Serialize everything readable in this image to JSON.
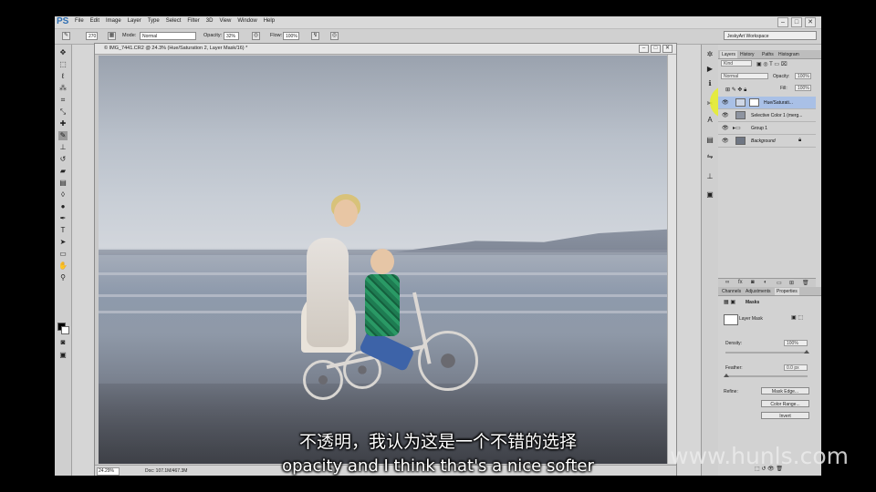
{
  "app": {
    "logo": "PS",
    "menu": [
      "File",
      "Edit",
      "Image",
      "Layer",
      "Type",
      "Select",
      "Filter",
      "3D",
      "View",
      "Window",
      "Help"
    ],
    "window_controls": [
      "–",
      "□",
      "✕"
    ],
    "workspace": "JeskyArt Workspace"
  },
  "options_bar": {
    "brush_size": "270",
    "mode_label": "Mode:",
    "mode_value": "Normal",
    "opacity_label": "Opacity:",
    "opacity_value": "32%",
    "flow_label": "Flow:",
    "flow_value": "100%"
  },
  "document": {
    "title": "© IMG_7441.CR2 @ 24.3% (Hue/Saturation 2, Layer Mask/16) *",
    "zoom": "24.29%",
    "doc_info": "Doc: 107.1M/467.3M",
    "controls": [
      "–",
      "□",
      "✕"
    ]
  },
  "layers_panel": {
    "tabs": [
      "Layers",
      "History",
      "Paths",
      "Histogram"
    ],
    "kind_label": "Kind",
    "blend_mode": "Normal",
    "opacity_label": "Opacity:",
    "opacity_value": "100%",
    "fill_label": "Fill:",
    "fill_value": "100%",
    "layers": [
      {
        "name": "Hue/Saturati...",
        "selected": true
      },
      {
        "name": "Selective Color 1 (merg...",
        "selected": false
      },
      {
        "name": "Group 1",
        "selected": false
      },
      {
        "name": "Background",
        "selected": false
      }
    ]
  },
  "properties_panel": {
    "tabs": [
      "Channels",
      "Adjustments",
      "Properties"
    ],
    "section": "Masks",
    "mask_type": "Layer Mask",
    "density_label": "Density:",
    "density_value": "100%",
    "feather_label": "Feather:",
    "feather_value": "0.0 px",
    "refine_label": "Refine:",
    "buttons": [
      "Mask Edge...",
      "Color Range...",
      "Invert"
    ]
  },
  "subtitles": {
    "chinese": "不透明，我认为这是一个不错的选择",
    "english": "opacity and I think that's a nice softer"
  },
  "watermark": "www.hunls.com"
}
